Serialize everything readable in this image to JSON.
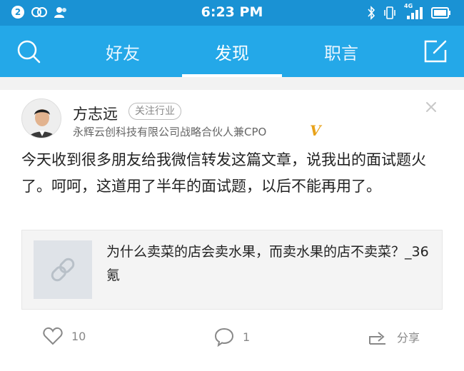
{
  "status_bar": {
    "notification_count": "2",
    "time": "6:23 PM",
    "network_label": "4G"
  },
  "nav": {
    "tabs": [
      {
        "label": "好友",
        "active": false
      },
      {
        "label": "发现",
        "active": true
      },
      {
        "label": "职言",
        "active": false
      }
    ],
    "accent": "#24a8e8"
  },
  "post": {
    "author": {
      "name": "方志远",
      "follow_tag": "关注行业",
      "title": "永辉云创科技有限公司战略合伙人兼CPO",
      "verified_mark": "V"
    },
    "text": "今天收到很多朋友给我微信转发这篇文章，说我出的面试题火了。呵呵，这道用了半年的面试题，以后不能再用了。",
    "link": {
      "title": "为什么卖菜的店会卖水果，而卖水果的店不卖菜？_36氪"
    },
    "actions": {
      "likes": "10",
      "comments": "1",
      "share_label": "分享"
    }
  }
}
